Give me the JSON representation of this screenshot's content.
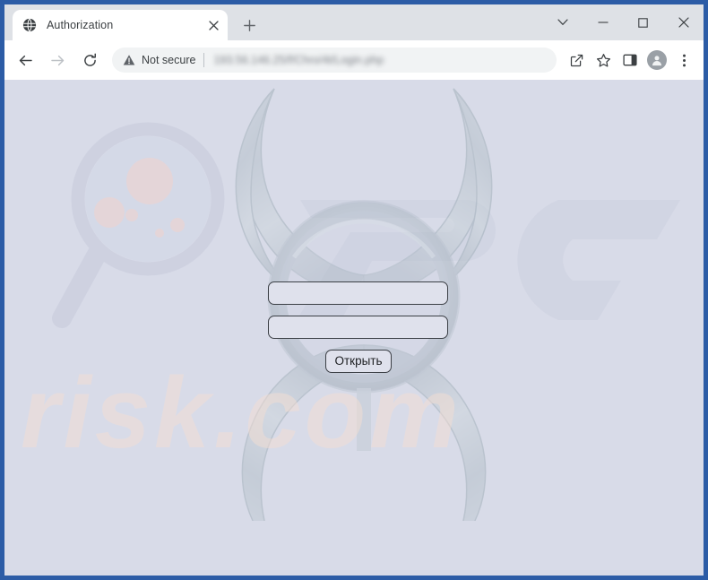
{
  "browser": {
    "tab": {
      "title": "Authorization",
      "favicon": "globe-icon",
      "close_label": "×"
    },
    "new_tab_label": "+",
    "window_controls": {
      "tab_search_label": "tab-search",
      "minimize_label": "minimize",
      "maximize_label": "maximize",
      "close_label": "close"
    },
    "toolbar": {
      "back_label": "back",
      "forward_label": "forward",
      "reload_label": "reload",
      "security_status": "Not secure",
      "security_icon": "warning-triangle-icon",
      "url": "193.56.146.25/f/Chro/4t/Login.php",
      "share_label": "share",
      "bookmark_label": "bookmark",
      "side_panel_label": "side-panel",
      "profile_label": "profile",
      "menu_label": "menu"
    }
  },
  "page": {
    "background_color": "#d8dbe8",
    "frame_color": "#2c5ca6",
    "form": {
      "username": {
        "value": "",
        "placeholder": ""
      },
      "password": {
        "value": "",
        "placeholder": ""
      },
      "submit_label": "Открыть"
    },
    "watermarks": {
      "logo_text": "PC",
      "site_text": "risk.com",
      "site_text_color": "#f4ded3",
      "magnifier_icon": "magnifying-glass-icon",
      "emblem_icon": "biohazard-icon"
    }
  }
}
